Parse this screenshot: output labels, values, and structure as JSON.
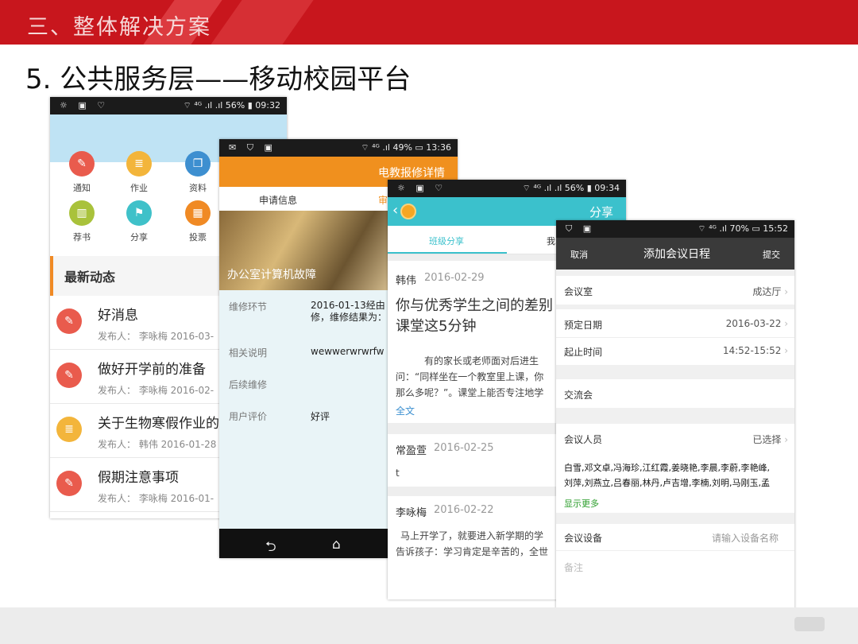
{
  "header": {
    "title": "三、整体解决方案"
  },
  "slide_subtitle": "5. 公共服务层——移动校园平台",
  "phone1": {
    "status": {
      "left_icons": "☼ ▣ ♡",
      "right": "⌔ ⁴ᴳ .ıl .ıl 56% ▮ 09:32"
    },
    "icons": [
      {
        "label": "通知",
        "icon": "megaphone-icon",
        "color": "#e95b4d",
        "glyph": "✎"
      },
      {
        "label": "作业",
        "icon": "document-icon",
        "color": "#f3b53b",
        "glyph": "≣"
      },
      {
        "label": "资料",
        "icon": "copy-icon",
        "color": "#3d8fd0",
        "glyph": "❐"
      },
      {
        "label": "荐书",
        "icon": "book-icon",
        "color": "#a9c23b",
        "glyph": "▥"
      },
      {
        "label": "分享",
        "icon": "flag-icon",
        "color": "#3fc1c9",
        "glyph": "⚑"
      },
      {
        "label": "投票",
        "icon": "bar-chart-icon",
        "color": "#f08a24",
        "glyph": "▦"
      }
    ],
    "section_title": "最新动态",
    "news": [
      {
        "title": "好消息",
        "meta": "发布人： 李咏梅   2016-03-",
        "color": "#e95b4d",
        "glyph": "✎"
      },
      {
        "title": "做好开学前的准备",
        "meta": "发布人： 李咏梅   2016-02-",
        "color": "#e95b4d",
        "glyph": "✎"
      },
      {
        "title": "关于生物寒假作业的",
        "meta": "发布人： 韩伟   2016-01-28",
        "color": "#f3b53b",
        "glyph": "≣"
      },
      {
        "title": "假期注意事项",
        "meta": "发布人： 李咏梅   2016-01-",
        "color": "#e95b4d",
        "glyph": "✎"
      }
    ]
  },
  "phone2": {
    "status": {
      "left_icons": "✉ ⛉ ▣",
      "right": "⌔ ⁴ᴳ .ıl 49% ▭ 13:36"
    },
    "title": "电教报修详情",
    "tabs": [
      "申请信息",
      "审"
    ],
    "banner_text": "办公室计算机故障",
    "fields": [
      {
        "label": "维修环节",
        "value": "2016-01-13经由\n修，维修结果为："
      },
      {
        "label": "相关说明",
        "value": "wewwerwrwrfw"
      },
      {
        "label": "后续维修",
        "value": ""
      },
      {
        "label": "用户评价",
        "value": "好评"
      }
    ],
    "nav": {
      "back": "⮌",
      "home": "⌂"
    }
  },
  "phone3": {
    "status": {
      "left_icons": "☼ ▣ ♡",
      "right": "⌔ ⁴ᴳ .ıl .ıl 56% ▮ 09:34"
    },
    "title": "分享",
    "back": "‹",
    "tabs": [
      "班级分享",
      "我"
    ],
    "posts": [
      {
        "author": "韩伟",
        "date": "2016-02-29",
        "headline": "你与优秀学生之间的差别\n课堂这5分钟",
        "body": "有的家长或老师面对后进生\n问：“同样坐在一个教室里上课，你\n那么多呢？”。课堂上能否专注地学",
        "link": "全文"
      },
      {
        "author": "常盈萱",
        "date": "2016-02-25",
        "body": "t"
      },
      {
        "author": "李咏梅",
        "date": "2016-02-22",
        "body": "马上开学了，就要进入新学期的学\n告诉孩子：学习肯定是辛苦的，全世"
      }
    ]
  },
  "phone4": {
    "status": {
      "left_icons": "⛉ ▣",
      "right": "⌔ ⁴ᴳ .ıl 70% ▭ 15:52"
    },
    "cancel": "取消",
    "title": "添加会议日程",
    "submit": "提交",
    "rows": {
      "room_label": "会议室",
      "room_value": "成达厅",
      "date_label": "预定日期",
      "date_value": "2016-03-22",
      "time_label": "起止时间",
      "time_value": "14:52-15:52",
      "topic": "交流会",
      "people_label": "会议人员",
      "people_value": "已选择",
      "people_list": "白雪,邓文卓,冯海珍,江红霞,姜晓艳,李晨,李蔚,李艳峰,\n刘萍,刘燕立,吕春丽,林丹,卢吉增,李楠,刘明,马刚玉,孟",
      "show_more": "显示更多",
      "device_label": "会议设备",
      "device_placeholder": "请输入设备名称",
      "note_placeholder": "备注"
    },
    "nav": {
      "back": "⮌",
      "home": "⌂",
      "recent": "❐"
    }
  }
}
